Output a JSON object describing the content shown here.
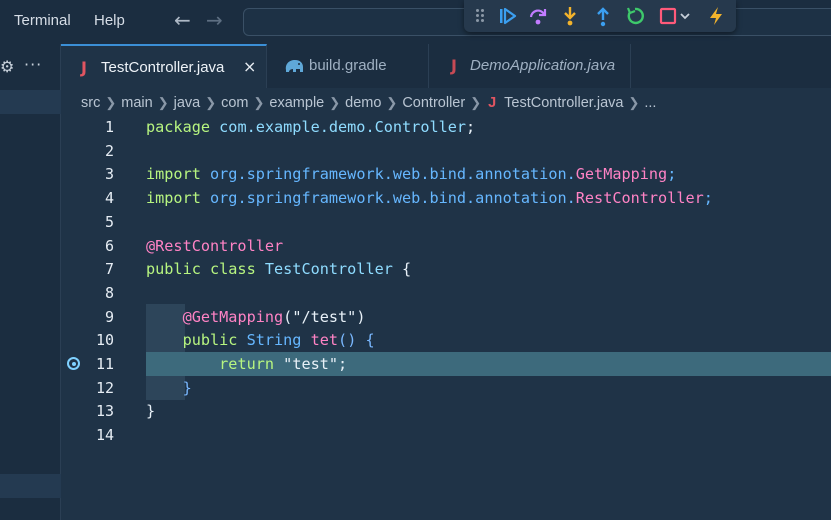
{
  "menu": {
    "items": [
      "Terminal",
      "Help"
    ]
  },
  "nav": {
    "back_icon": "arrow-left-icon",
    "forward_icon": "arrow-right-icon"
  },
  "debug_toolbar": {
    "buttons": [
      "continue-icon",
      "step-over-icon",
      "step-into-icon",
      "step-out-icon",
      "restart-icon",
      "stop-icon",
      "hot-code-replace-icon"
    ],
    "colors": {
      "continue": "#3b9ff0",
      "step": "#c27cff",
      "step_into": "#f2b32c",
      "step_out": "#3b9ff0",
      "restart": "#3ec96b",
      "stop": "#ff5a7a",
      "hot_replace": "#f2b32c"
    }
  },
  "tabs": [
    {
      "icon": "J",
      "label": "TestController.java",
      "active": true,
      "close": "×"
    },
    {
      "icon": "gradle-elephant-icon",
      "label": "build.gradle",
      "active": false
    },
    {
      "icon": "J",
      "label": "DemoApplication.java",
      "active": false
    }
  ],
  "breadcrumb": {
    "parts": [
      "src",
      "main",
      "java",
      "com",
      "example",
      "demo",
      "Controller"
    ],
    "file": "TestController.java",
    "more": "..."
  },
  "editor": {
    "current_line": 11,
    "line_numbers": [
      "1",
      "2",
      "3",
      "4",
      "5",
      "6",
      "7",
      "8",
      "9",
      "10",
      "11",
      "12",
      "13",
      "14"
    ],
    "lines": [
      [
        [
          "kw",
          "package "
        ],
        [
          "ident",
          "com.example.demo.Controller"
        ],
        [
          "punc",
          ";"
        ]
      ],
      [],
      [
        [
          "kw",
          "import "
        ],
        [
          "pkg",
          "org.springframework.web.bind.annotation."
        ],
        [
          "cls",
          "GetMapping"
        ],
        [
          "pkg",
          ";"
        ]
      ],
      [
        [
          "kw",
          "import "
        ],
        [
          "pkg",
          "org.springframework.web.bind.annotation."
        ],
        [
          "cls",
          "RestController"
        ],
        [
          "pkg",
          ";"
        ]
      ],
      [],
      [
        [
          "ann",
          "@RestController"
        ]
      ],
      [
        [
          "kw",
          "public class "
        ],
        [
          "ident",
          "TestController "
        ],
        [
          "punc",
          "{"
        ]
      ],
      [],
      [
        [
          "punc",
          "    "
        ],
        [
          "ann",
          "@GetMapping"
        ],
        [
          "punc",
          "(\"/test\")"
        ]
      ],
      [
        [
          "punc",
          "    "
        ],
        [
          "kw",
          "public "
        ],
        [
          "typ",
          "String "
        ],
        [
          "fn",
          "tet"
        ],
        [
          "brace",
          "() {"
        ]
      ],
      [
        [
          "punc",
          "        "
        ],
        [
          "kw",
          "return "
        ],
        [
          "str",
          "\"test\""
        ],
        [
          "punc",
          ";"
        ]
      ],
      [
        [
          "brace",
          "    }"
        ]
      ],
      [
        [
          "punc",
          "}"
        ]
      ],
      []
    ]
  }
}
